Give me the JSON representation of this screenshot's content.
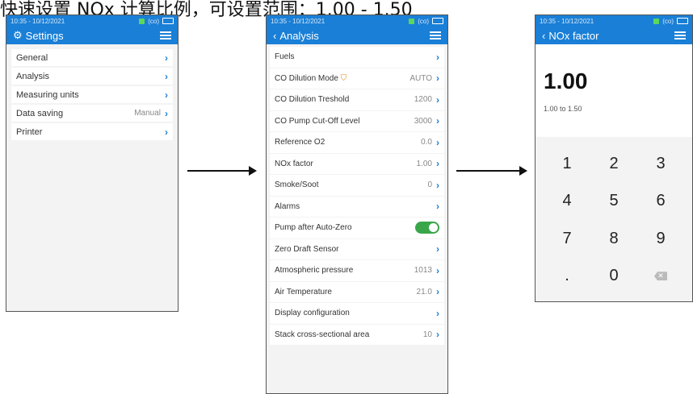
{
  "caption": "快速设置 NOx 计算比例，可设置范围：1.00 - 1.50",
  "screen1": {
    "status_time": "10:35 - 10/12/2021",
    "status_signal": "(co)",
    "title": "Settings",
    "items": [
      {
        "label": "General",
        "value": ""
      },
      {
        "label": "Analysis",
        "value": ""
      },
      {
        "label": "Measuring units",
        "value": ""
      },
      {
        "label": "Data saving",
        "value": "Manual"
      },
      {
        "label": "Printer",
        "value": ""
      }
    ]
  },
  "screen2": {
    "status_time": "10:35 - 10/12/2021",
    "status_signal": "(co)",
    "title": "Analysis",
    "items": [
      {
        "label": "Fuels",
        "value": ""
      },
      {
        "label": "CO Dilution Mode",
        "value": "AUTO"
      },
      {
        "label": "CO Dilution Treshold",
        "value": "1200"
      },
      {
        "label": "CO Pump Cut-Off Level",
        "value": "3000"
      },
      {
        "label": "Reference O2",
        "value": "0.0"
      },
      {
        "label": "NOx factor",
        "value": "1.00"
      },
      {
        "label": "Smoke/Soot",
        "value": "0"
      },
      {
        "label": "Alarms",
        "value": ""
      },
      {
        "label": "Pump after Auto-Zero",
        "value": ""
      },
      {
        "label": "Zero Draft Sensor",
        "value": ""
      },
      {
        "label": "Atmospheric pressure",
        "value": "1013"
      },
      {
        "label": "Air Temperature",
        "value": "21.0"
      },
      {
        "label": "Display configuration",
        "value": ""
      },
      {
        "label": "Stack cross-sectional area",
        "value": "10"
      }
    ],
    "pump_toggle_on": true
  },
  "screen3": {
    "status_time": "10:35 - 10/12/2021",
    "status_signal": "(co)",
    "title": "NOx factor",
    "value": "1.00",
    "range": "1.00 to 1.50",
    "keys": [
      "1",
      "2",
      "3",
      "4",
      "5",
      "6",
      "7",
      "8",
      "9",
      ".",
      "0",
      "⌫"
    ]
  },
  "colors": {
    "accent": "#1a7fd6",
    "toggle": "#3aa64a"
  }
}
